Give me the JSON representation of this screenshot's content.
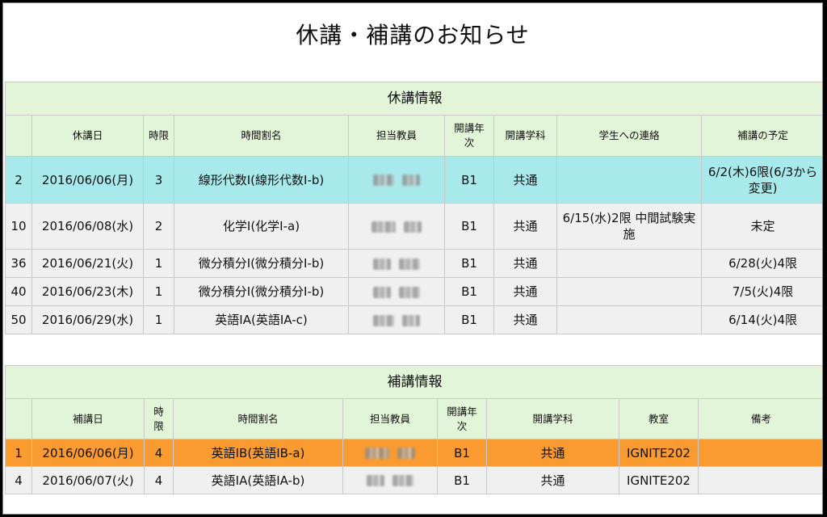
{
  "page_title": "休講・補講のお知らせ",
  "cancellations": {
    "caption": "休講情報",
    "headers": [
      "",
      "休講日",
      "時限",
      "時間割名",
      "担当教員",
      "開講年次",
      "開講学科",
      "学生への連絡",
      "補講の予定"
    ],
    "rows": [
      {
        "no": "2",
        "date": "2016/06/06(月)",
        "period": "3",
        "course": "線形代数Ⅰ(線形代数Ⅰ-b)",
        "year": "B1",
        "dept": "共通",
        "note": "",
        "makeup": "6/2(木)6限(6/3から変更)"
      },
      {
        "no": "10",
        "date": "2016/06/08(水)",
        "period": "2",
        "course": "化学Ⅰ(化学Ⅰ-a)",
        "year": "B1",
        "dept": "共通",
        "note": "6/15(水)2限 中間試験実施",
        "makeup": "未定"
      },
      {
        "no": "36",
        "date": "2016/06/21(火)",
        "period": "1",
        "course": "微分積分Ⅰ(微分積分Ⅰ-b)",
        "year": "B1",
        "dept": "共通",
        "note": "",
        "makeup": "6/28(火)4限"
      },
      {
        "no": "40",
        "date": "2016/06/23(木)",
        "period": "1",
        "course": "微分積分Ⅰ(微分積分Ⅰ-b)",
        "year": "B1",
        "dept": "共通",
        "note": "",
        "makeup": "7/5(火)4限"
      },
      {
        "no": "50",
        "date": "2016/06/29(水)",
        "period": "1",
        "course": "英語ⅠA(英語ⅠA-c)",
        "year": "B1",
        "dept": "共通",
        "note": "",
        "makeup": "6/14(火)4限"
      }
    ]
  },
  "makeups": {
    "caption": "補講情報",
    "headers": [
      "",
      "補講日",
      "時限",
      "時間割名",
      "担当教員",
      "開講年次",
      "開講学科",
      "教室",
      "備考"
    ],
    "rows": [
      {
        "no": "1",
        "date": "2016/06/06(月)",
        "period": "4",
        "course": "英語ⅠB(英語ⅠB-a)",
        "year": "B1",
        "dept": "共通",
        "room": "IGNITE202",
        "remarks": ""
      },
      {
        "no": "4",
        "date": "2016/06/07(火)",
        "period": "4",
        "course": "英語ⅠA(英語ⅠA-b)",
        "year": "B1",
        "dept": "共通",
        "room": "IGNITE202",
        "remarks": ""
      }
    ]
  },
  "colors": {
    "header_bg": "#e3f5d8",
    "row_bg": "#f0f0f0",
    "highlight_cyan": "#a8e9ec",
    "highlight_orange": "#f99b30"
  }
}
